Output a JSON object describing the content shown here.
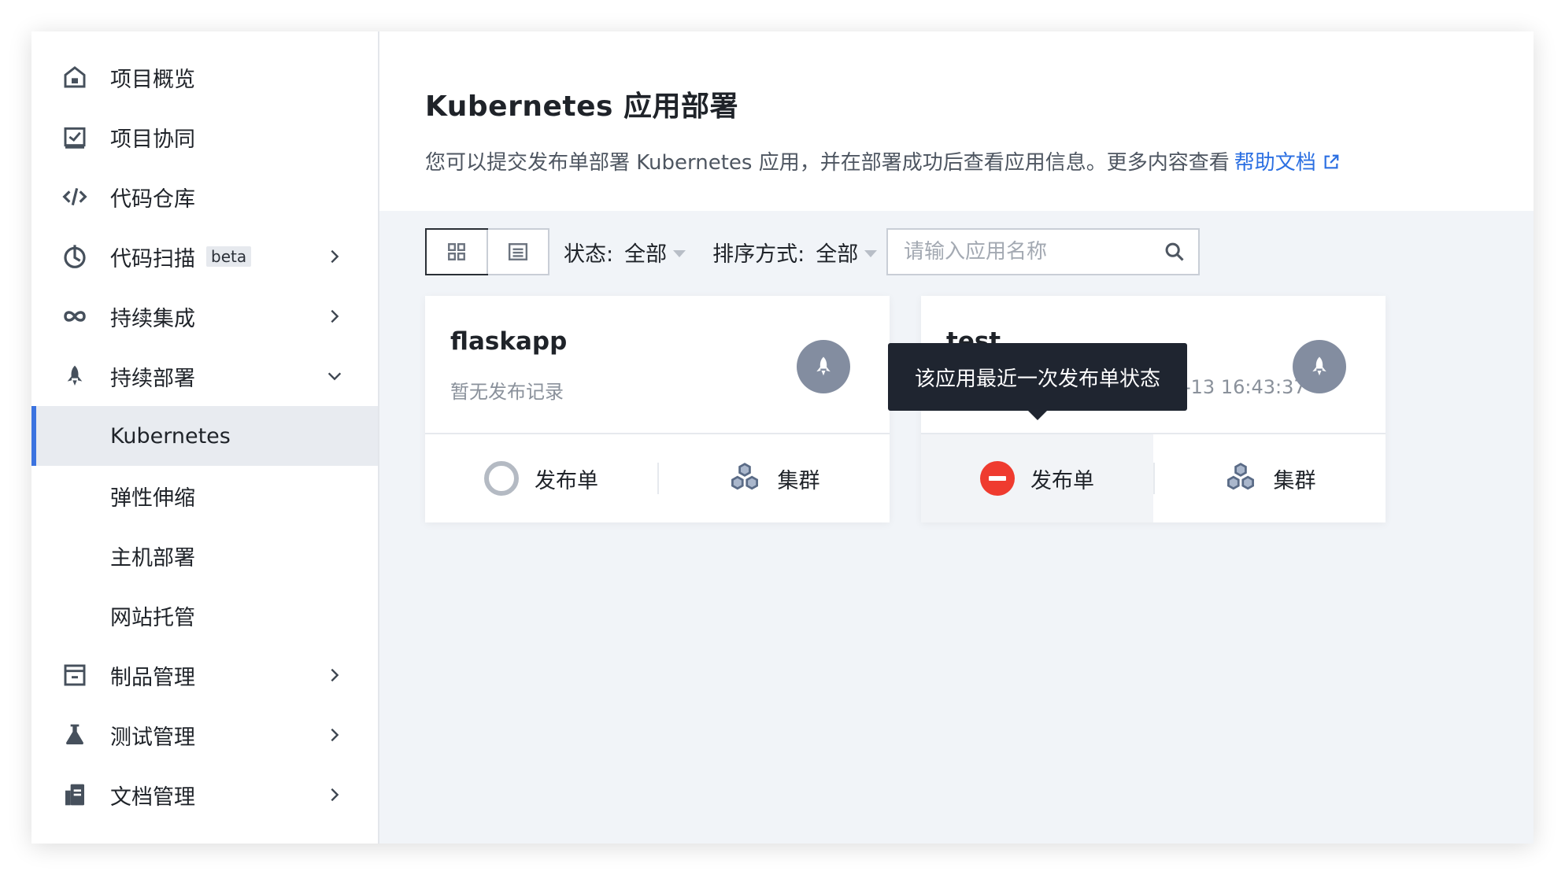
{
  "sidebar": {
    "items": [
      {
        "label": "项目概览",
        "icon": "home-icon"
      },
      {
        "label": "项目协同",
        "icon": "checkbox-icon"
      },
      {
        "label": "代码仓库",
        "icon": "code-icon"
      },
      {
        "label": "代码扫描",
        "badge": "beta",
        "icon": "scan-icon"
      },
      {
        "label": "持续集成",
        "icon": "infinity-icon"
      },
      {
        "label": "持续部署",
        "icon": "rocket-icon"
      },
      {
        "label": "Kubernetes"
      },
      {
        "label": "弹性伸缩"
      },
      {
        "label": "主机部署"
      },
      {
        "label": "网站托管"
      },
      {
        "label": "制品管理",
        "icon": "package-icon"
      },
      {
        "label": "测试管理",
        "icon": "flask-icon"
      },
      {
        "label": "文档管理",
        "icon": "document-icon"
      }
    ]
  },
  "header": {
    "title": "Kubernetes 应用部署",
    "description": "您可以提交发布单部署 Kubernetes 应用，并在部署成功后查看应用信息。更多内容查看",
    "help_link": "帮助文档"
  },
  "toolbar": {
    "status_label": "状态:",
    "status_value": "全部",
    "sort_label": "排序方式:",
    "sort_value": "全部",
    "search_placeholder": "请输入应用名称"
  },
  "cards": [
    {
      "name": "flaskapp",
      "subtitle": "暂无发布记录",
      "release_label": "发布单",
      "cluster_label": "集群",
      "release_status": "none"
    },
    {
      "name": "test",
      "subtitle": "-13 16:43:37",
      "release_label": "发布单",
      "cluster_label": "集群",
      "release_status": "failed"
    }
  ],
  "tooltip": {
    "text": "该应用最近一次发布单状态"
  },
  "colors": {
    "accent": "#3b73e0",
    "link": "#2b6fe2",
    "failed": "#ef3b2f",
    "tooltip_bg": "#1f2530"
  }
}
